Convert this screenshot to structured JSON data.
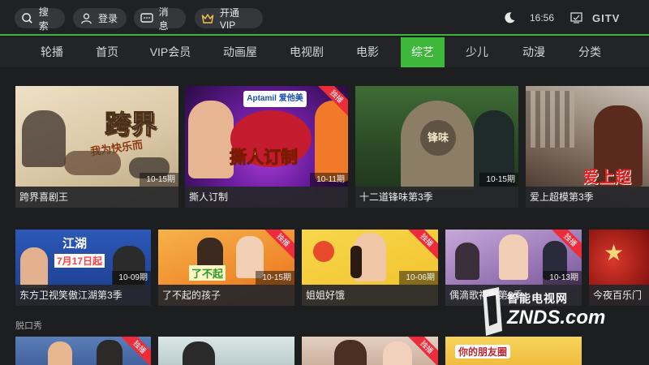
{
  "topbar": {
    "search": "搜索",
    "login": "登录",
    "messages": "消息",
    "vip": "开通VIP",
    "time": "16:56",
    "brand": "GITV"
  },
  "nav": [
    "轮播",
    "首页",
    "VIP会员",
    "动画屋",
    "电视剧",
    "电影",
    "综艺",
    "少儿",
    "动漫",
    "分类"
  ],
  "nav_active": "综艺",
  "row1": [
    {
      "title": "跨界喜剧王",
      "episode": "10-15期",
      "badge": ""
    },
    {
      "title": "撕人订制",
      "episode": "10-11期",
      "badge": "独播"
    },
    {
      "title": "十二道锋味第3季",
      "episode": "10-15期",
      "badge": ""
    },
    {
      "title": "爱上超模第3季",
      "episode": "",
      "badge": ""
    }
  ],
  "row2": [
    {
      "title": "东方卫视笑傲江湖第3季",
      "episode": "10-09期",
      "badge": ""
    },
    {
      "title": "了不起的孩子",
      "episode": "10-15期",
      "badge": "独播"
    },
    {
      "title": "姐姐好饿",
      "episode": "10-06期",
      "badge": "独播"
    },
    {
      "title": "偶滴歌神啊第3季",
      "episode": "10-13期",
      "badge": "独播"
    },
    {
      "title": "今夜百乐门",
      "episode": "",
      "badge": ""
    }
  ],
  "section": "脱口秀",
  "row3_badges": [
    "独播",
    "",
    "独播",
    ""
  ],
  "tile_texts": {
    "t1": "跨界",
    "t1b": "我为快乐而",
    "t2": "撕人订制",
    "t2b": "Aptamil 爱他美",
    "t3": "锋味",
    "t4": "爱上超",
    "t5": "江湖",
    "t5b": "7月17日起",
    "t6": "了不起",
    "t8": "你的朋友圈"
  },
  "watermark": {
    "line1": "智能电视网",
    "line2": "ZNDS.com"
  }
}
